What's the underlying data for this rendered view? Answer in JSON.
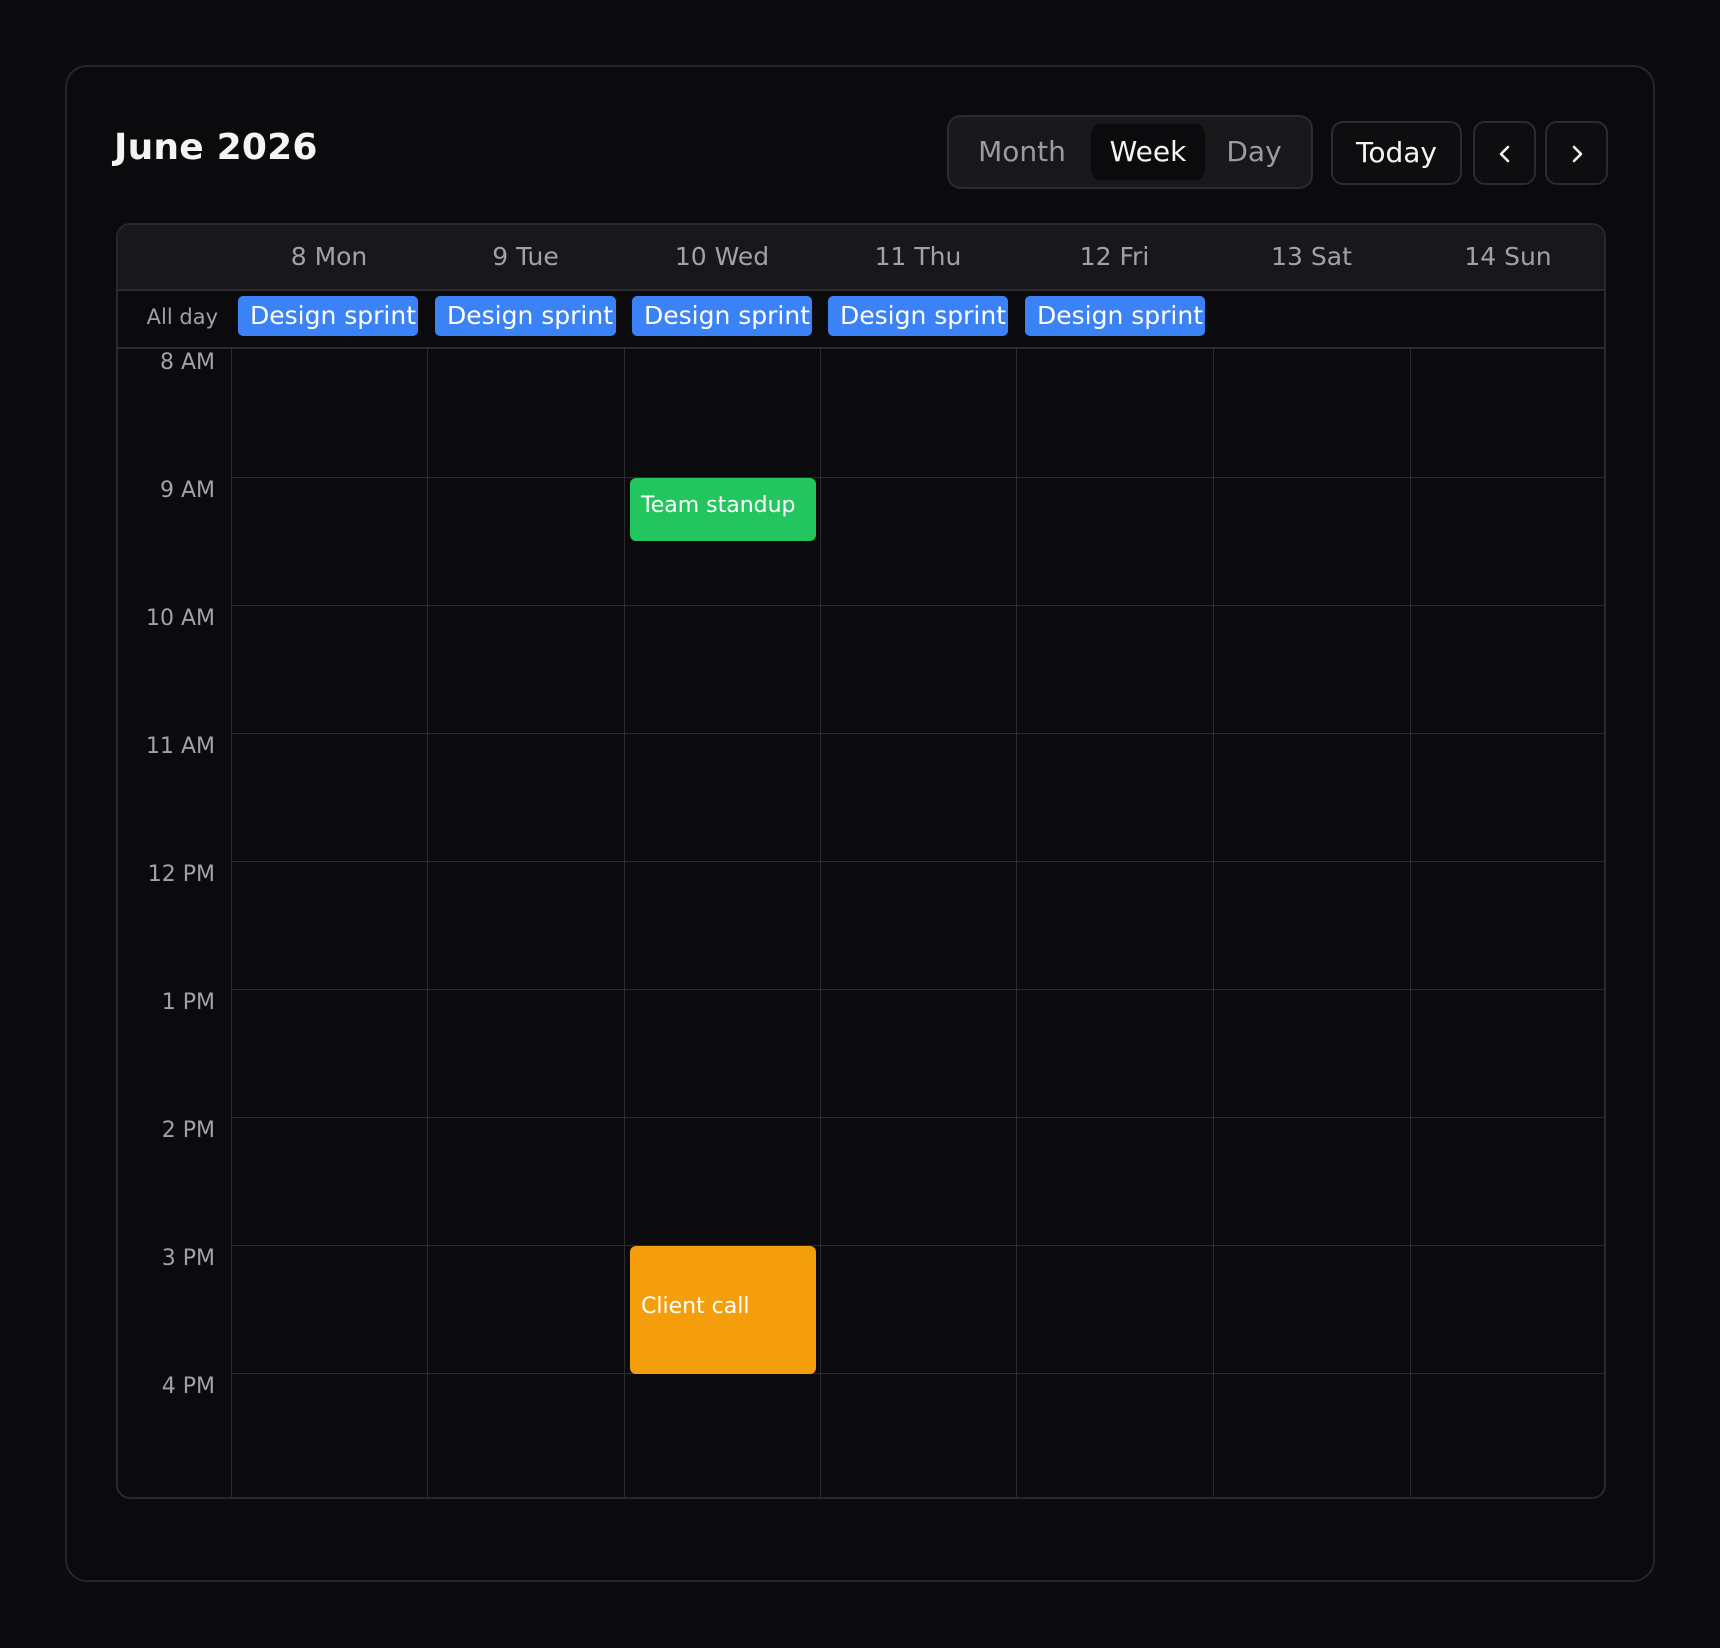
{
  "header": {
    "title": "June 2026",
    "views": [
      "Month",
      "Week",
      "Day"
    ],
    "active_view": "Week",
    "today_label": "Today",
    "prev_icon": "chevron-left-icon",
    "next_icon": "chevron-right-icon"
  },
  "days": [
    "8 Mon",
    "9 Tue",
    "10 Wed",
    "11 Thu",
    "12 Fri",
    "13 Sat",
    "14 Sun"
  ],
  "allday": {
    "label": "All day",
    "events": [
      {
        "title": "Design sprint",
        "day": "8 Mon"
      },
      {
        "title": "Design sprint",
        "day": "9 Tue"
      },
      {
        "title": "Design sprint",
        "day": "10 Wed"
      },
      {
        "title": "Design sprint",
        "day": "11 Thu"
      },
      {
        "title": "Design sprint",
        "day": "12 Fri"
      }
    ]
  },
  "hours": [
    "8 AM",
    "9 AM",
    "10 AM",
    "11 AM",
    "12 PM",
    "1 PM",
    "2 PM",
    "3 PM",
    "4 PM"
  ],
  "events": [
    {
      "title": "Team standup",
      "day": "10 Wed",
      "start": "9 AM"
    },
    {
      "title": "Client call",
      "day": "10 Wed",
      "start": "3 PM"
    }
  ],
  "colors": {
    "background": "#0c0c0e",
    "allday_event": "#3b82f6",
    "standup": "#22c55e",
    "client_call": "#f59e0b"
  }
}
